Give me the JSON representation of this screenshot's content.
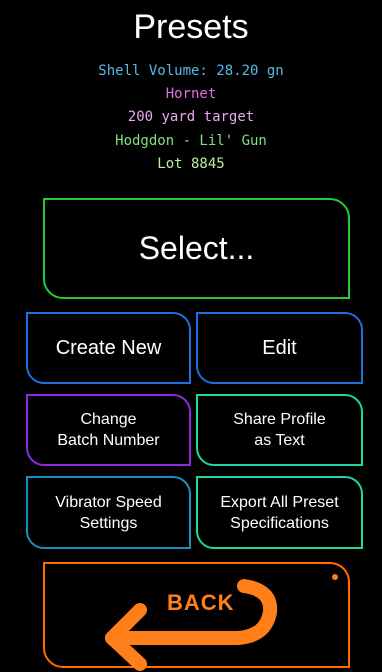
{
  "header": {
    "title": "Presets",
    "shell_volume": "Shell Volume: 28.20 gn",
    "cartridge": "Hornet",
    "target": "200 yard target",
    "powder": "Hodgdon - Lil' Gun",
    "lot": "Lot 8845"
  },
  "buttons": {
    "select": "Select...",
    "create_new": "Create New",
    "edit": "Edit",
    "change_batch_line1": "Change",
    "change_batch_line2": "Batch Number",
    "share_line1": "Share Profile",
    "share_line2": "as Text",
    "vibrator_line1": "Vibrator Speed",
    "vibrator_line2": "Settings",
    "export_line1": "Export All Preset",
    "export_line2": "Specifications",
    "back": "BACK"
  },
  "icons": {
    "back": "back-arrow-icon"
  },
  "colors": {
    "shell_volume": "#5ab8e8",
    "cartridge": "#e070e0",
    "target": "#e8a8f0",
    "powder": "#7fe07f",
    "lot": "#b8f0a0",
    "select_border": "#22cc33",
    "blue_border": "#1e6fe0",
    "purple_border": "#8a2be2",
    "teal_border": "#1ed7a8",
    "cyan_border": "#1a8fbf",
    "back_border": "#ff6a00",
    "back_arrow": "#ff7f1a"
  }
}
